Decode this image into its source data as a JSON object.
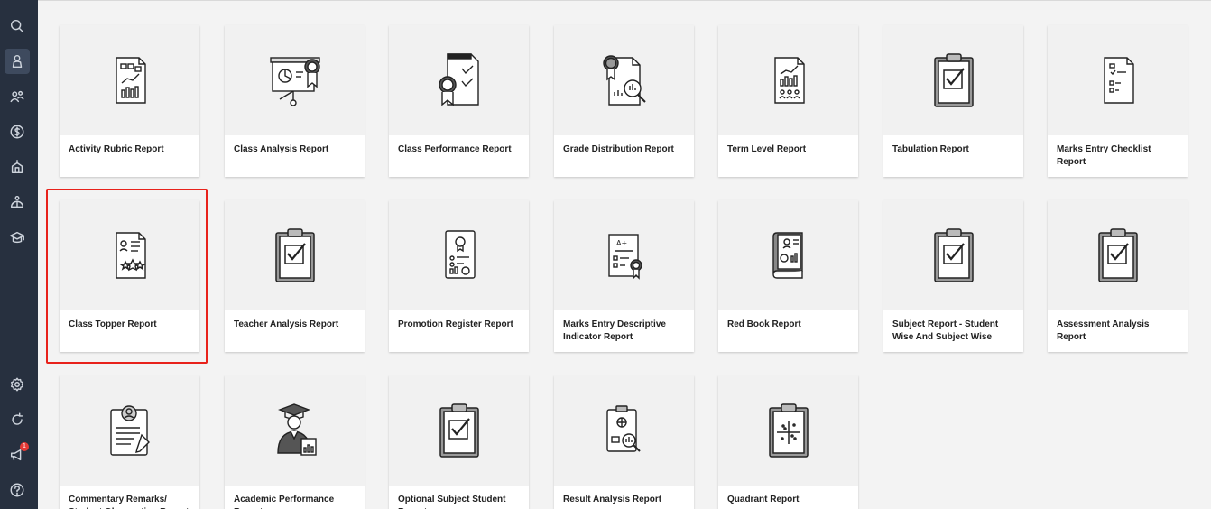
{
  "sidebar": {
    "items": [
      {
        "name": "search-icon",
        "active": false
      },
      {
        "name": "student-icon",
        "active": true
      },
      {
        "name": "people-icon",
        "active": false
      },
      {
        "name": "dollar-icon",
        "active": false
      },
      {
        "name": "building-icon",
        "active": false
      },
      {
        "name": "network-icon",
        "active": false
      },
      {
        "name": "graduation-icon",
        "active": false
      }
    ],
    "bottom": [
      {
        "name": "gear-icon"
      },
      {
        "name": "refresh-icon"
      },
      {
        "name": "megaphone-icon",
        "badge": "1"
      },
      {
        "name": "help-icon"
      }
    ]
  },
  "reports": [
    {
      "label": "Activity Rubric Report",
      "icon": "report-sheet-icon"
    },
    {
      "label": "Class Analysis Report",
      "icon": "presentation-icon"
    },
    {
      "label": "Class Performance Report",
      "icon": "checklist-award-icon"
    },
    {
      "label": "Grade Distribution Report",
      "icon": "grade-magnifier-icon"
    },
    {
      "label": "Term Level Report",
      "icon": "report-sheet-icon"
    },
    {
      "label": "Tabulation Report",
      "icon": "clipboard-check-icon"
    },
    {
      "label": "Marks Entry Checklist Report",
      "icon": "checklist-sheet-icon"
    },
    {
      "label": "Class Topper Report",
      "icon": "topper-sheet-icon"
    },
    {
      "label": "Teacher Analysis Report",
      "icon": "clipboard-check-icon"
    },
    {
      "label": "Promotion Register Report",
      "icon": "promotion-sheet-icon"
    },
    {
      "label": "Marks Entry Descriptive Indicator Report",
      "icon": "grade-award-icon"
    },
    {
      "label": "Red Book Report",
      "icon": "book-icon"
    },
    {
      "label": "Subject Report - Student Wise And Subject Wise",
      "icon": "clipboard-check-icon"
    },
    {
      "label": "Assessment Analysis Report",
      "icon": "clipboard-check-icon"
    },
    {
      "label": "Commentary Remarks/ Student Observation Report",
      "icon": "clipboard-profile-icon"
    },
    {
      "label": "Academic Performance Report",
      "icon": "graduate-icon"
    },
    {
      "label": "Optional Subject Student Report",
      "icon": "clipboard-check-icon"
    },
    {
      "label": "Result Analysis Report",
      "icon": "clipboard-magnifier-icon"
    },
    {
      "label": "Quadrant Report",
      "icon": "clipboard-quadrant-icon"
    }
  ],
  "colors": {
    "sidebar_bg": "#27303f",
    "highlight": "#e8221b",
    "badge": "#e53935"
  }
}
